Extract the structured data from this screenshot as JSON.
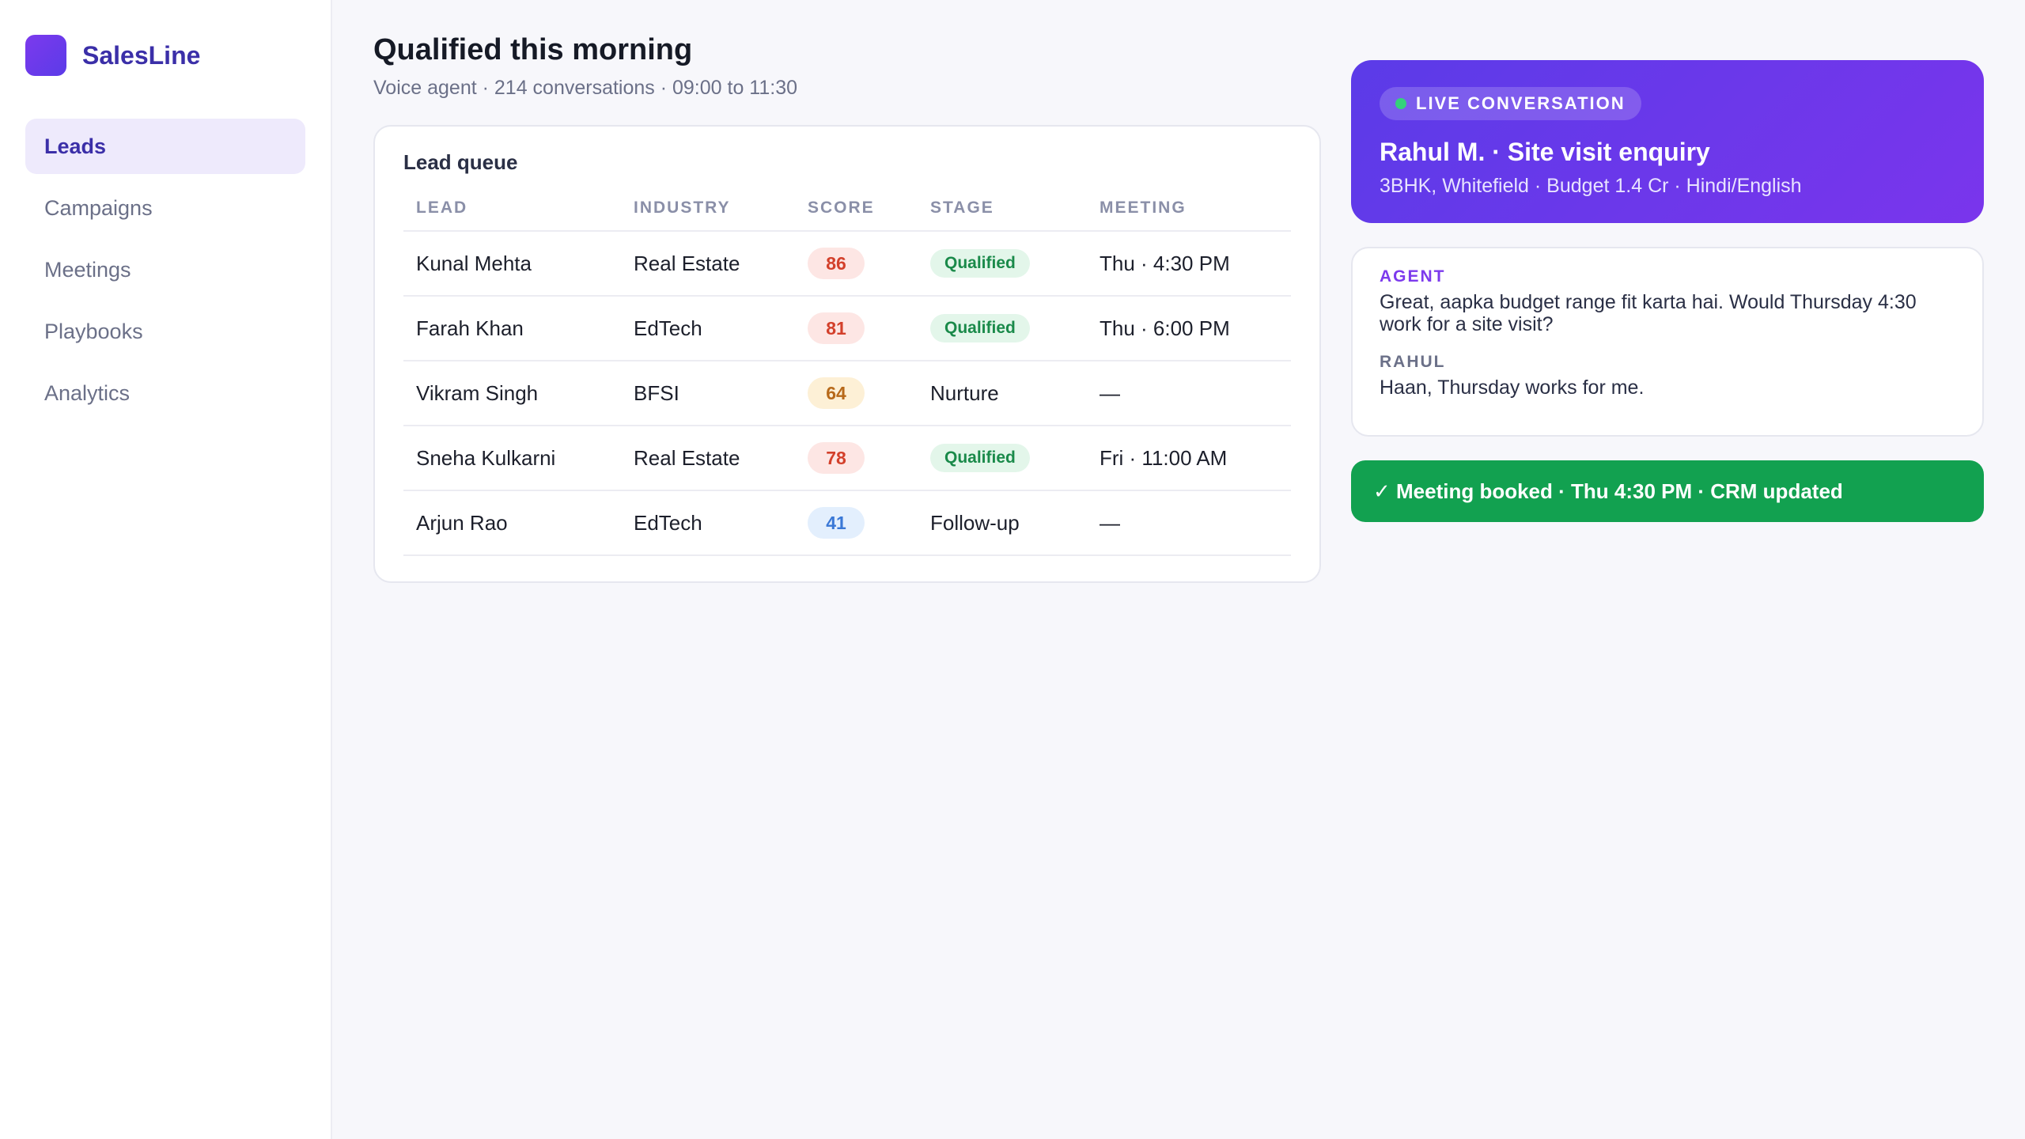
{
  "brand": {
    "name": "SalesLine"
  },
  "sidebar": {
    "items": [
      {
        "label": "Leads",
        "active": true
      },
      {
        "label": "Campaigns",
        "active": false
      },
      {
        "label": "Meetings",
        "active": false
      },
      {
        "label": "Playbooks",
        "active": false
      },
      {
        "label": "Analytics",
        "active": false
      }
    ]
  },
  "header": {
    "title": "Qualified this morning",
    "subtitle": "Voice agent · 214 conversations · 09:00 to 11:30"
  },
  "queue": {
    "title": "Lead queue",
    "columns": [
      "LEAD",
      "INDUSTRY",
      "SCORE",
      "STAGE",
      "MEETING"
    ],
    "rows": [
      {
        "lead": "Kunal Mehta",
        "industry": "Real Estate",
        "score": "86",
        "stage": "Qualified",
        "meeting": "Thu · 4:30 PM"
      },
      {
        "lead": "Farah Khan",
        "industry": "EdTech",
        "score": "81",
        "stage": "Qualified",
        "meeting": "Thu · 6:00 PM"
      },
      {
        "lead": "Vikram Singh",
        "industry": "BFSI",
        "score": "64",
        "stage": "Nurture",
        "meeting": "—"
      },
      {
        "lead": "Sneha Kulkarni",
        "industry": "Real Estate",
        "score": "78",
        "stage": "Qualified",
        "meeting": "Fri · 11:00 AM"
      },
      {
        "lead": "Arjun Rao",
        "industry": "EdTech",
        "score": "41",
        "stage": "Follow-up",
        "meeting": "—"
      }
    ]
  },
  "live": {
    "badge": "LIVE CONVERSATION",
    "title": "Rahul M. · Site visit enquiry",
    "subtitle": "3BHK, Whitefield · Budget 1.4 Cr · Hindi/English"
  },
  "transcript": {
    "agent_label": "AGENT",
    "agent_text": "Great, aapka budget range fit karta hai. Would Thursday 4:30 work for a site visit?",
    "rahul_label": "RAHUL",
    "rahul_text": "Haan, Thursday works for me."
  },
  "banner": {
    "text": "✓ Meeting booked · Thu 4:30 PM · CRM updated"
  },
  "colors": {
    "accent": "#5b3be8",
    "brand_text": "#3b2fa8",
    "success": "#12a150",
    "score_hot": "#d3402b",
    "score_warm": "#b7691a",
    "score_cold": "#3a78d6"
  }
}
